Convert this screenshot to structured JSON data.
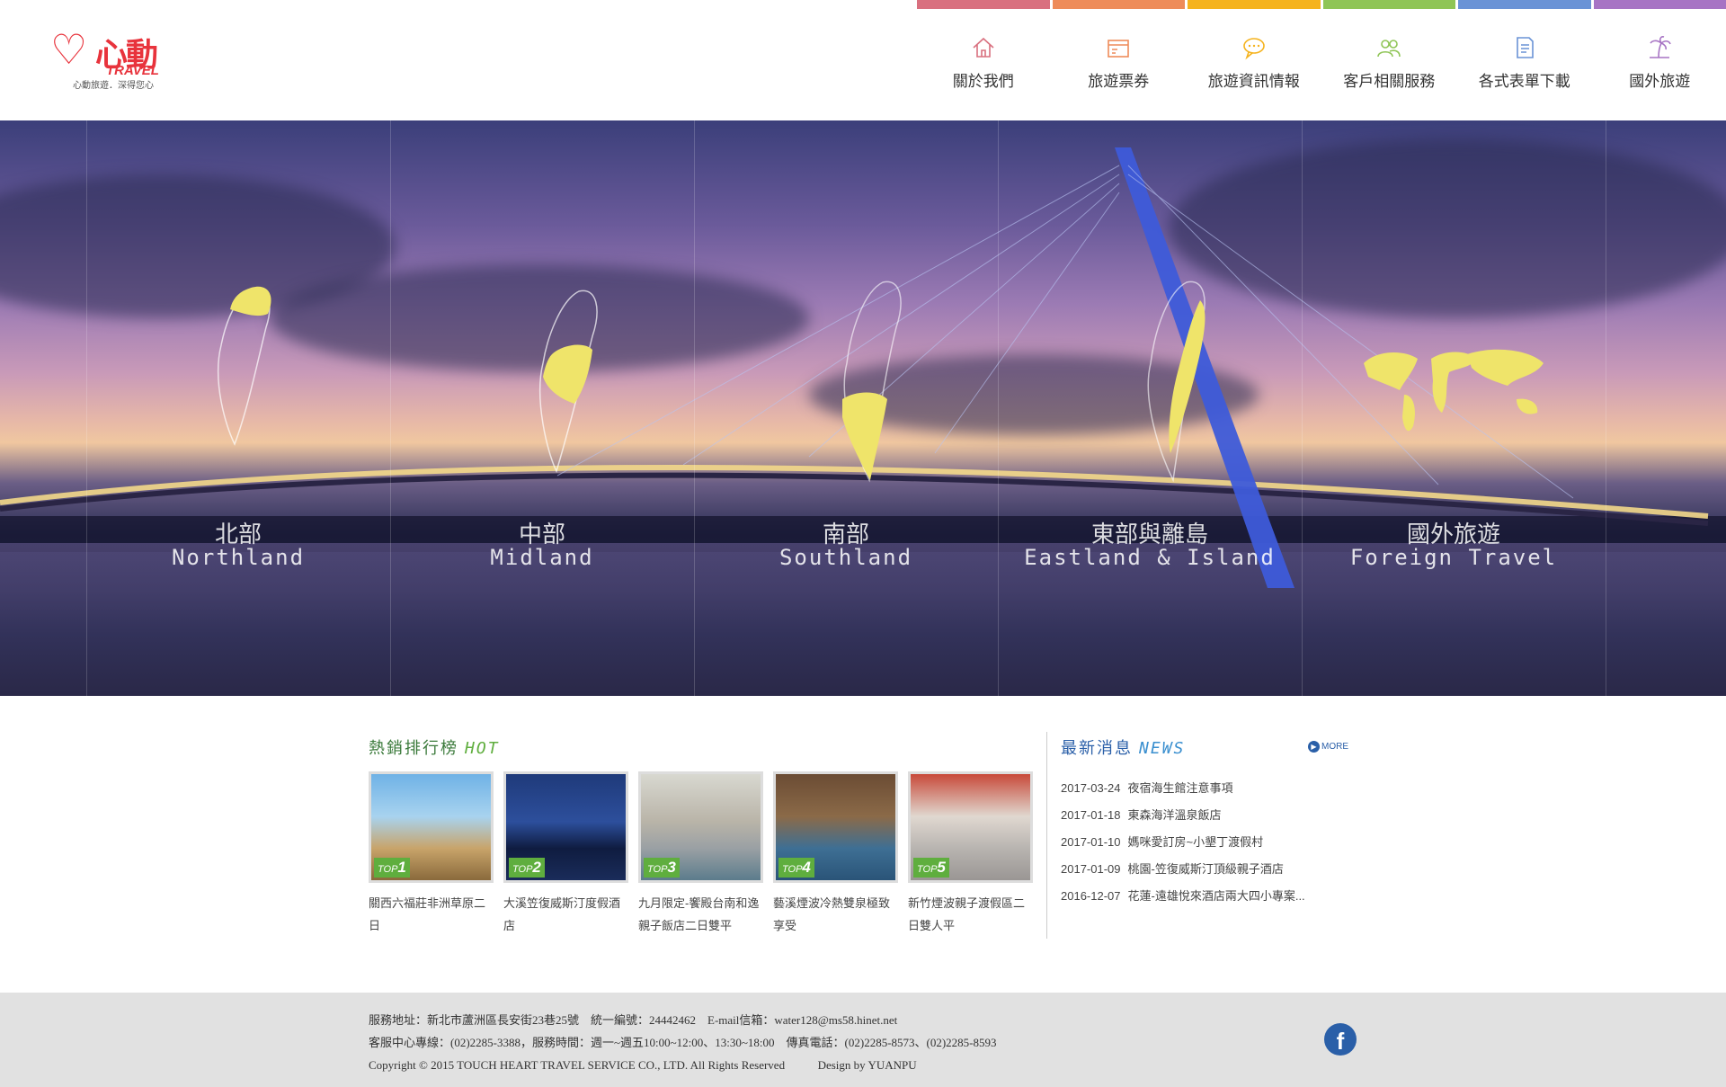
{
  "brand": {
    "logo_text": "心動",
    "logo_sub": "TRAVEL",
    "slogan": "心動旅遊．深得您心"
  },
  "nav": [
    {
      "label": "關於我們",
      "color": "#d9707f",
      "icon": "home-icon"
    },
    {
      "label": "旅遊票券",
      "color": "#ee8c5a",
      "icon": "ticket-icon"
    },
    {
      "label": "旅遊資訊情報",
      "color": "#f5b31e",
      "icon": "chat-icon"
    },
    {
      "label": "客戶相關服務",
      "color": "#8fc556",
      "icon": "users-icon"
    },
    {
      "label": "各式表單下載",
      "color": "#6a93d6",
      "icon": "document-icon"
    },
    {
      "label": "國外旅遊",
      "color": "#a774c4",
      "icon": "palm-tree-icon"
    }
  ],
  "regions": [
    {
      "zh": "北部",
      "en": "Northland",
      "icon": "taiwan-north-map-icon"
    },
    {
      "zh": "中部",
      "en": "Midland",
      "icon": "taiwan-central-map-icon"
    },
    {
      "zh": "南部",
      "en": "Southland",
      "icon": "taiwan-south-map-icon"
    },
    {
      "zh": "東部與離島",
      "en": "Eastland & Island",
      "icon": "taiwan-east-map-icon"
    },
    {
      "zh": "國外旅遊",
      "en": "Foreign Travel",
      "icon": "world-map-icon"
    }
  ],
  "hot": {
    "title": "熱銷排行榜",
    "title_accent": "HOT",
    "items": [
      {
        "rank_prefix": "TOP",
        "rank": "1",
        "caption": "關西六福莊非洲草原二日"
      },
      {
        "rank_prefix": "TOP",
        "rank": "2",
        "caption": "大溪笠復威斯汀度假酒店"
      },
      {
        "rank_prefix": "TOP",
        "rank": "3",
        "caption": "九月限定-饗殿台南和逸親子飯店二日雙平"
      },
      {
        "rank_prefix": "TOP",
        "rank": "4",
        "caption": "藝溪煙波冷熱雙泉極致享受"
      },
      {
        "rank_prefix": "TOP",
        "rank": "5",
        "caption": "新竹煙波親子渡假區二日雙人平"
      }
    ]
  },
  "news": {
    "title": "最新消息",
    "title_accent": "NEWS",
    "more_label": "MORE",
    "items": [
      {
        "date": "2017-03-24",
        "title": "夜宿海生館注意事項"
      },
      {
        "date": "2017-01-18",
        "title": "東森海洋溫泉飯店"
      },
      {
        "date": "2017-01-10",
        "title": "媽咪愛訂房~小墾丁渡假村"
      },
      {
        "date": "2017-01-09",
        "title": "桃園-笠復威斯汀頂級親子酒店"
      },
      {
        "date": "2016-12-07",
        "title": "花蓮-遠雄悅來酒店兩大四小專案..."
      }
    ]
  },
  "footer": {
    "line1": "服務地址：新北市蘆洲區長安街23巷25號　統一編號：24442462　E-mail信箱：water128@ms58.hinet.net",
    "line2": "客服中心專線：(02)2285-3388，服務時間：週一~週五10:00~12:00、13:30~18:00　傳真電話：(02)2285-8573、(02)2285-8593",
    "copyright": "Copyright © 2015 TOUCH HEART TRAVEL SERVICE CO., LTD. All Rights Reserved",
    "design": "Design by YUANPU",
    "facebook_icon": "facebook-icon"
  }
}
